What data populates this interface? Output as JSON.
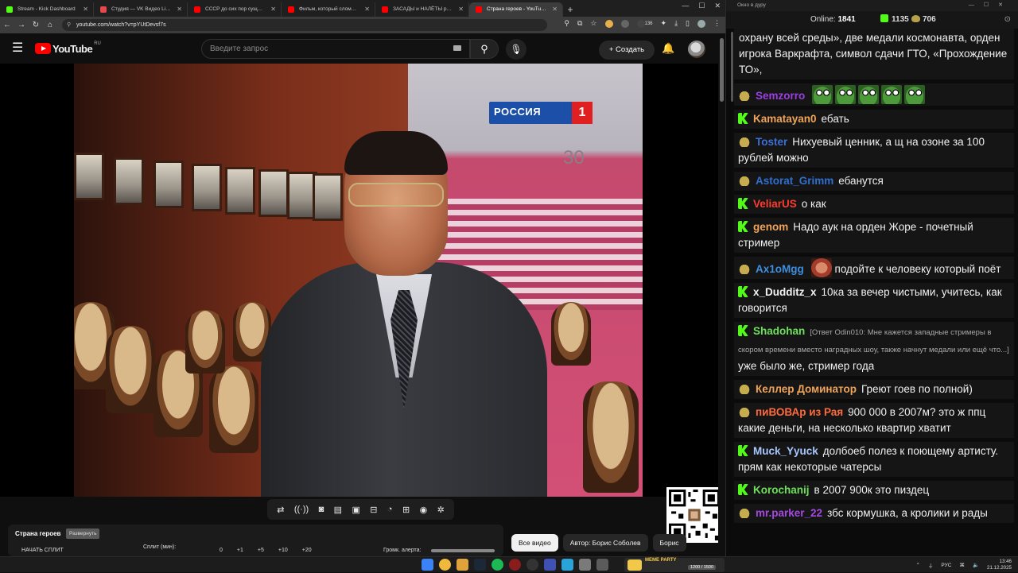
{
  "browser": {
    "tabs": [
      {
        "label": "Stream - Kick Dashboard",
        "icon": "kick",
        "active": false
      },
      {
        "label": "Студия — VK Видео Live",
        "icon": "vk",
        "active": false
      },
      {
        "label": "СССР до сих пор существует",
        "icon": "yt",
        "active": false
      },
      {
        "label": "Фильм, который сломал Томск",
        "icon": "yt",
        "active": false
      },
      {
        "label": "ЗАСАДЫ и НАЛЁТЫ русских Р",
        "icon": "yt",
        "active": false
      },
      {
        "label": "Страна героев - YouTube",
        "icon": "yt",
        "active": true
      }
    ],
    "url": "youtube.com/watch?v=pYUtDevsf7s",
    "ext_badge": "136"
  },
  "youtube": {
    "logo_text": "YouTube",
    "region": "RU",
    "search_placeholder": "Введите запрос",
    "create_label": "Создать",
    "video_channel_logo": "РОССИЯ",
    "video_channel_num": "1",
    "video_bg_number": "30",
    "chips": [
      {
        "label": "Все видео",
        "active": true
      },
      {
        "label": "Автор: Борис Соболев",
        "active": false
      },
      {
        "label": "Борис",
        "active": false
      }
    ]
  },
  "split_panel": {
    "title": "Страна героев",
    "badge": "Развернуть",
    "start_label": "НАЧАТЬ СПЛИТ",
    "minutes_label": "Сплит (мин):",
    "steps": [
      "0",
      "+1",
      "+5",
      "+10",
      "+20"
    ],
    "volume_label": "Громк. алерта:"
  },
  "chat": {
    "window_title": "Окно в дуру",
    "online_label": "Online:",
    "online_value": "1841",
    "kick_count": "1135",
    "pepe_count": "706",
    "messages": [
      {
        "platform": "",
        "nick": "",
        "color": "#ffffff",
        "reply": "",
        "text": "охрану всей среды», две медали космонавта, орден игрока Варкрафта, символ сдачи ГТО, «Прохождение ТО»,",
        "emotes": []
      },
      {
        "platform": "pepe",
        "nick": "Semzorro",
        "color": "#9b3fe5",
        "reply": "",
        "text": "",
        "emotes": [
          "pepe",
          "pepe",
          "pepe",
          "pepe",
          "pepe"
        ]
      },
      {
        "platform": "kick",
        "nick": "Kamatayan0",
        "color": "#f0a45a",
        "reply": "",
        "text": "ебать",
        "emotes": []
      },
      {
        "platform": "pepe",
        "nick": "Toster",
        "color": "#3d6fd6",
        "reply": "",
        "text": "Нихуевый ценник, а щ на озоне за 100 рублей можно",
        "emotes": []
      },
      {
        "platform": "pepe",
        "nick": "Astorat_Grimm",
        "color": "#2f6fd0",
        "reply": "",
        "text": "ебанутся",
        "emotes": []
      },
      {
        "platform": "kick",
        "nick": "VeliarUS",
        "color": "#ff3b30",
        "reply": "",
        "text": "о как",
        "emotes": []
      },
      {
        "platform": "kick",
        "nick": "genom",
        "color": "#f0a45a",
        "reply": "",
        "text": "Надо аук на орден Жоре - почетный стример",
        "emotes": []
      },
      {
        "platform": "pepe",
        "nick": "Ax1oMgg",
        "color": "#3d8fe0",
        "reply": "",
        "text": "подойте к человеку который поёт",
        "emotes": [
          "face"
        ]
      },
      {
        "platform": "kick",
        "nick": "x_Dudditz_x",
        "color": "#f2f2f2",
        "reply": "",
        "text": "10ка за вечер чистыми, учитесь, как говорится",
        "emotes": []
      },
      {
        "platform": "kick",
        "nick": "Shadohan",
        "color": "#6ee05a",
        "reply": "[Ответ Odin010: Мне кажется западные стримеры в скором времени вместо наградных шоу, также начнут медали или ещё что...]",
        "text": "уже было же, стример года",
        "emotes": []
      },
      {
        "platform": "pepe",
        "nick": "Келлер Доминатор",
        "color": "#f0a45a",
        "reply": "",
        "text": "Греют гоев по полной)",
        "emotes": []
      },
      {
        "platform": "pepe",
        "nick": "пиВОВАр из Рая",
        "color": "#ff6a3d",
        "reply": "",
        "text": "900 000 в 2007м? это ж ппц какие деньги, на несколько квартир хватит",
        "emotes": []
      },
      {
        "platform": "kick",
        "nick": "Muck_Yyuck",
        "color": "#a9c7ff",
        "reply": "",
        "text": "долбоеб полез к поющему артисту. прям как некоторые чатерсы",
        "emotes": []
      },
      {
        "platform": "kick",
        "nick": "Korochanij",
        "color": "#6ee05a",
        "reply": "",
        "text": "в 2007 900к это пиздец",
        "emotes": []
      },
      {
        "platform": "pepe",
        "nick": "mr.parker_22",
        "color": "#a44ae0",
        "reply": "",
        "text": "збс кормушка, а кролики и рады",
        "emotes": []
      }
    ]
  },
  "taskbar": {
    "meme_label": "MEME PARTY",
    "meme_count": "1200 / 1500",
    "lang": "РУС",
    "time": "13:46",
    "date": "21.12.2025"
  },
  "colors": {
    "kick_green": "#53fc18",
    "youtube_red": "#ff0000"
  }
}
